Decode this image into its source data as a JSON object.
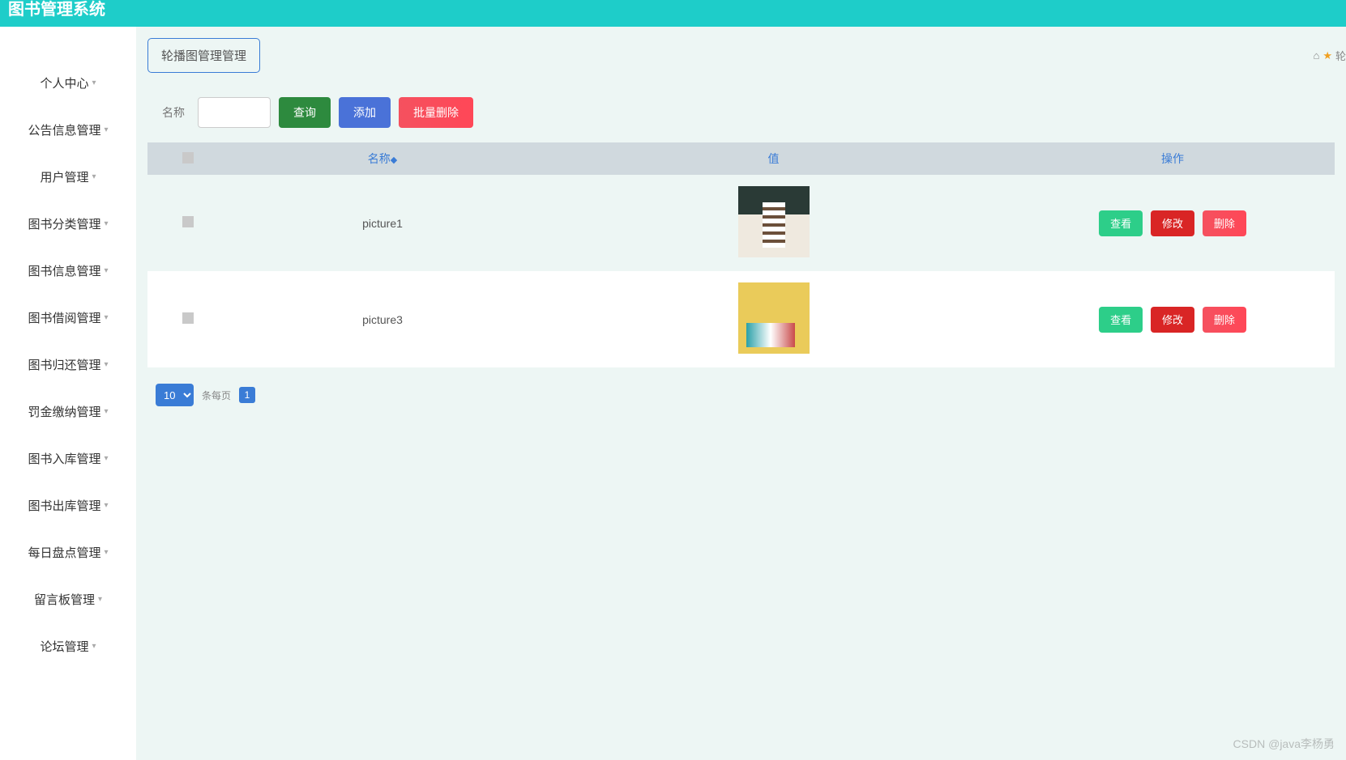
{
  "header": {
    "title": "图书管理系统"
  },
  "sidebar": {
    "items": [
      {
        "label": "个人中心"
      },
      {
        "label": "公告信息管理"
      },
      {
        "label": "用户管理"
      },
      {
        "label": "图书分类管理"
      },
      {
        "label": "图书信息管理"
      },
      {
        "label": "图书借阅管理"
      },
      {
        "label": "图书归还管理"
      },
      {
        "label": "罚金缴纳管理"
      },
      {
        "label": "图书入库管理"
      },
      {
        "label": "图书出库管理"
      },
      {
        "label": "每日盘点管理"
      },
      {
        "label": "留言板管理"
      },
      {
        "label": "论坛管理"
      }
    ]
  },
  "page": {
    "tag": "轮播图管理管理",
    "breadcrumb_tail": "轮"
  },
  "toolbar": {
    "search_label": "名称",
    "search_value": "",
    "query_label": "查询",
    "add_label": "添加",
    "bulk_delete_label": "批量删除"
  },
  "table": {
    "headers": {
      "name": "名称",
      "value": "值",
      "action": "操作"
    },
    "rows": [
      {
        "name": "picture1"
      },
      {
        "name": "picture3"
      }
    ],
    "actions": {
      "view": "查看",
      "edit": "修改",
      "delete": "删除"
    }
  },
  "pager": {
    "page_size": "10",
    "per_page_text": "条每页",
    "current_page": "1"
  },
  "watermark": "CSDN @java李杨勇"
}
